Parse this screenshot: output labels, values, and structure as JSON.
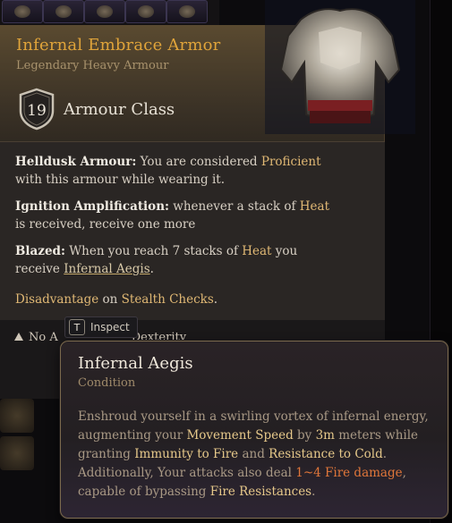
{
  "item": {
    "name": "Infernal Embrace Armor",
    "rarity_type": "Legendary Heavy Armour",
    "armour_class_value": "19",
    "armour_class_label": "Armour Class"
  },
  "properties": {
    "helldusk": {
      "label": "Helldusk Armour:",
      "text_before": "You are considered ",
      "highlight": "Proficient",
      "text_after": " with this armour while wearing it."
    },
    "ignition": {
      "label": "Ignition Amplification:",
      "text_before": "whenever a stack of ",
      "highlight": "Heat",
      "text_after": " is received, receive one more"
    },
    "blazed": {
      "label": "Blazed:",
      "text_before": "When you reach 7 stacks of ",
      "highlight": "Heat",
      "text_after": " you receive ",
      "link": "Infernal Aegis",
      "end": "."
    },
    "disadvantage": {
      "highlight": "Disadvantage",
      "text_before": " on ",
      "highlight2": "Stealth Checks",
      "end": "."
    }
  },
  "footer": {
    "warning_left": "No A",
    "warning_right": "Dexterity"
  },
  "inspect": {
    "key": "T",
    "label": "Inspect"
  },
  "condition_tooltip": {
    "title": "Infernal Aegis",
    "subtitle": "Condition",
    "p1": "Enshroud yourself in a swirling vortex of infernal energy, augmenting your ",
    "movement_speed": "Movement Speed",
    "p2": " by ",
    "distance": "3m",
    "p3": " meters while granting ",
    "immunity": "Immunity to Fire",
    "p4": " and ",
    "resistance": "Resistance to Cold",
    "p5": ". Additionally, Your attacks also deal ",
    "damage": "1~4 Fire damage",
    "p6": ", capable of bypassing ",
    "fire_res": "Fire Resistances",
    "p7": "."
  },
  "colors": {
    "title_gold": "#e0a43a",
    "keyword_gold": "#e6c88a",
    "fire_orange": "#e0763a"
  }
}
